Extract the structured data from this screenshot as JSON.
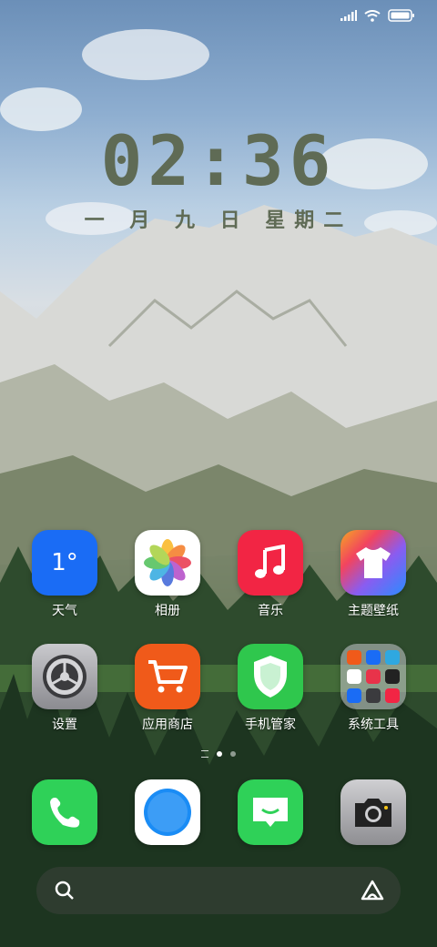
{
  "lockscreen": {
    "time": "02:36",
    "date": "一 月 九 日 星期二"
  },
  "status_bar": {
    "icons": [
      "cellular-signal-icon",
      "wifi-icon",
      "battery-icon"
    ]
  },
  "apps": [
    {
      "label": "天气",
      "icon": "weather-icon",
      "value": "1°",
      "color": "#1a6cf5"
    },
    {
      "label": "相册",
      "icon": "photos-icon",
      "color": "#ffffff"
    },
    {
      "label": "音乐",
      "icon": "music-icon",
      "color": "#f22544"
    },
    {
      "label": "主题壁纸",
      "icon": "themes-icon",
      "color": "#8a5cf0"
    },
    {
      "label": "设置",
      "icon": "settings-icon",
      "color": "#9a9a9e"
    },
    {
      "label": "应用商店",
      "icon": "app-store-icon",
      "color": "#f05a1a"
    },
    {
      "label": "手机管家",
      "icon": "security-icon",
      "color": "#2fc74d"
    },
    {
      "label": "系统工具",
      "icon": "system-tools-folder-icon",
      "color": "#c7c9cf"
    }
  ],
  "dock": [
    {
      "icon": "phone-icon",
      "color": "#2fd158"
    },
    {
      "icon": "browser-icon",
      "color": "#ffffff"
    },
    {
      "icon": "messages-icon",
      "color": "#2fd158"
    },
    {
      "icon": "camera-icon",
      "color": "#9c9c9c"
    }
  ],
  "page_indicator": {
    "pages": 2,
    "current": 1
  },
  "search_bar": {
    "left_icon": "search-icon",
    "right_icon": "assistant-icon"
  }
}
